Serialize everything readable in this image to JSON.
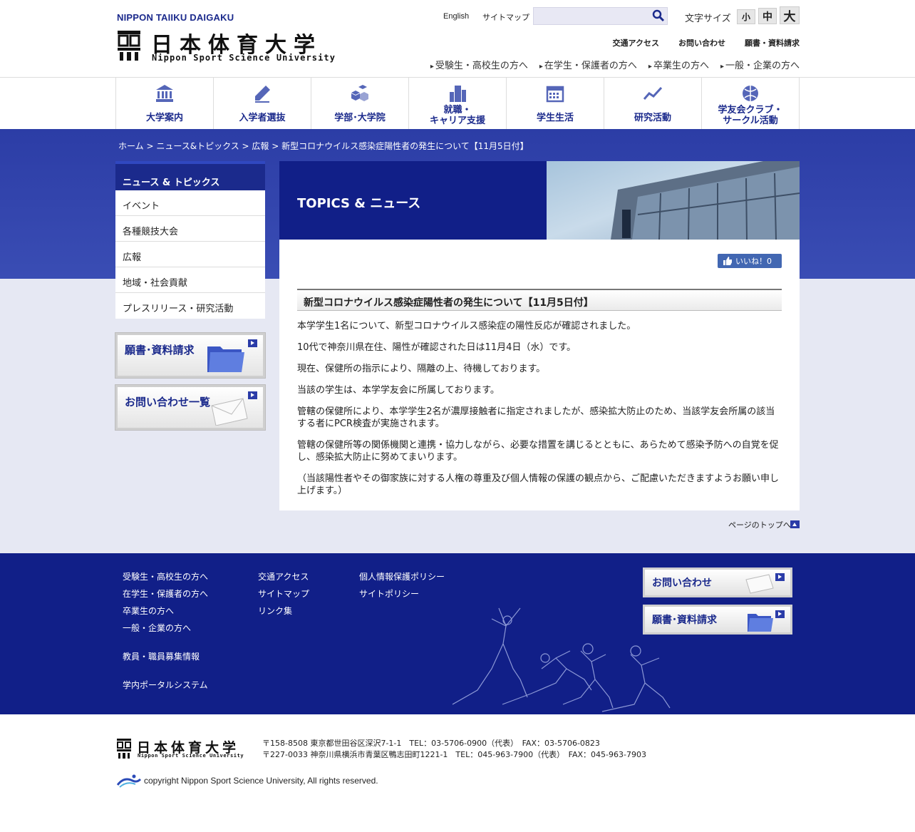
{
  "header": {
    "logo_romaji": "NIPPON TAIIKU DAIGAKU",
    "logo_jp": "日本体育大学",
    "logo_en": "Nippon Sport Science University",
    "english": "English",
    "sitemap": "サイトマップ",
    "search_placeholder": "",
    "font_size_label": "文字サイズ",
    "font_small": "小",
    "font_mid": "中",
    "font_large": "大",
    "util_links": [
      "交通アクセス",
      "お問い合わせ",
      "願書・資料請求"
    ],
    "target_links": [
      "受験生・高校生の方へ",
      "在学生・保護者の方へ",
      "卒業生の方へ",
      "一般・企業の方へ"
    ]
  },
  "gnav": [
    {
      "label": "大学案内",
      "icon": "building-icon"
    },
    {
      "label": "入学者選抜",
      "icon": "pencil-icon"
    },
    {
      "label": "学部･大学院",
      "icon": "cubes-icon"
    },
    {
      "label": "就職・\nキャリア支援",
      "icon": "city-icon"
    },
    {
      "label": "学生生活",
      "icon": "calendar-icon"
    },
    {
      "label": "研究活動",
      "icon": "chart-line-icon"
    },
    {
      "label": "学友会クラブ・\nサークル活動",
      "icon": "ball-icon"
    }
  ],
  "breadcrumb": "ホーム > ニュース&トピックス > 広報 > 新型コロナウイルス感染症陽性者の発生について【11月5日付】",
  "sidebar": {
    "heading": "ニュース & トピックス",
    "items": [
      "イベント",
      "各種競技大会",
      "広報",
      "地域・社会貢献",
      "プレスリリース・研究活動"
    ],
    "banner_application": "願書･資料請求",
    "banner_contact": "お問い合わせ一覧"
  },
  "main": {
    "header_title": "TOPICS & ニュース",
    "like_label": "いいね！0",
    "article_title": "新型コロナウイルス感染症陽性者の発生について【11月5日付】",
    "paragraphs": [
      "本学学生1名について、新型コロナウイルス感染症の陽性反応が確認されました。",
      "10代で神奈川県在住、陽性が確認された日は11月4日（水）です。",
      "現在、保健所の指示により、隔離の上、待機しております。",
      "当該の学生は、本学学友会に所属しております。",
      "管轄の保健所により、本学学生2名が濃厚接触者に指定されましたが、感染拡大防止のため、当該学友会所属の該当する者にPCR検査が実施されます。",
      "管轄の保健所等の関係機関と連携・協力しながら、必要な措置を講じるとともに、あらためて感染予防への自覚を促し、感染拡大防止に努めてまいります。",
      "（当該陽性者やその御家族に対する人権の尊重及び個人情報の保護の観点から、ご配慮いただきますようお願い申し上げます。）"
    ],
    "pagetop": "ページのトップへ"
  },
  "footer": {
    "col1": [
      "受験生・高校生の方へ",
      "在学生・保護者の方へ",
      "卒業生の方へ",
      "一般・企業の方へ"
    ],
    "col1_extra": [
      "教員・職員募集情報",
      "学内ポータルシステム"
    ],
    "col2": [
      "交通アクセス",
      "サイトマップ",
      "リンク集"
    ],
    "col3": [
      "個人情報保護ポリシー",
      "サイトポリシー"
    ],
    "banner_contact": "お問い合わせ",
    "banner_application": "願書･資料請求"
  },
  "bottom": {
    "logo_jp": "日本体育大学",
    "logo_en": "Nippon Sport Science University",
    "address1": "〒158-8508 東京都世田谷区深沢7-1-1　TEL：03-5706-0900（代表）　FAX：03-5706-0823",
    "address2": "〒227-0033 神奈川県横浜市青葉区鴨志田町1221-1　TEL：045-963-7900（代表）　FAX：045-963-7903",
    "copyright": "copyright Nippon Sport Science University, All rights reserved."
  },
  "colors": {
    "brand_navy": "#111f88",
    "band_blue": "#2c3da6",
    "nav_text": "#1b2a8c",
    "facebook": "#4267b2"
  }
}
